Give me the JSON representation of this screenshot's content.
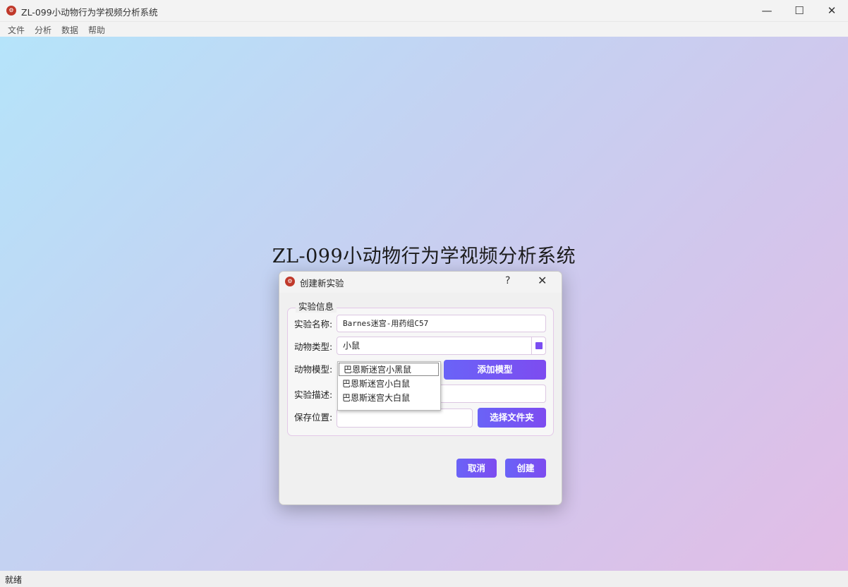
{
  "window": {
    "title": "ZL-099小动物行为学视频分析系统",
    "controls": {
      "minimize": "—",
      "maximize": "☐",
      "close": "✕"
    }
  },
  "menu": [
    "文件",
    "分析",
    "数据",
    "帮助"
  ],
  "main": {
    "title": "ZL-099小动物行为学视频分析系统"
  },
  "status": {
    "text": "就绪"
  },
  "dialog": {
    "title": "创建新实验",
    "help": "?",
    "close": "✕",
    "group_title": "实验信息",
    "labels": {
      "name": "实验名称:",
      "animal_type": "动物类型:",
      "animal_model": "动物模型:",
      "description": "实验描述:",
      "save_path": "保存位置:"
    },
    "fields": {
      "name": "Barnes迷宫-用药组C57",
      "animal_type": "小鼠",
      "description": "",
      "save_path": ""
    },
    "model_options": [
      "巴恩斯迷宫小黑鼠",
      "巴恩斯迷宫小白鼠",
      "巴恩斯迷宫大白鼠"
    ],
    "buttons": {
      "add_model": "添加模型",
      "choose_folder": "选择文件夹",
      "cancel": "取消",
      "create": "创建"
    },
    "colors": {
      "accent": "#7b4df2",
      "button_start": "#6a63f7",
      "border": "#dcc7e2"
    }
  }
}
